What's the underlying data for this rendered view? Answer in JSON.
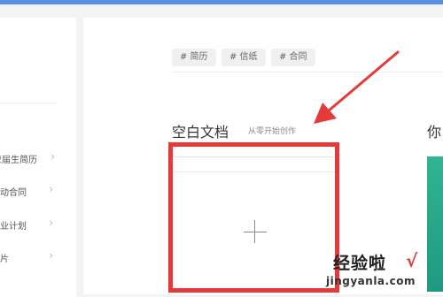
{
  "sidebar": {
    "items": [
      {
        "label": "应届生简历"
      },
      {
        "label": "劳动合同"
      },
      {
        "label": "创业计划"
      },
      {
        "label": "名片"
      }
    ]
  },
  "tags": [
    {
      "label": "# 简历"
    },
    {
      "label": "# 信纸"
    },
    {
      "label": "# 合同"
    }
  ],
  "blank_section": {
    "title": "空白文档",
    "subtitle": "从零开始创作"
  },
  "next_section": {
    "title": "你"
  },
  "card": {
    "icon": "plus-icon"
  },
  "annotation": {
    "color": "#e53a3a"
  },
  "watermark": {
    "main": "经验啦",
    "check": "√",
    "sub": "jingyanla.com"
  },
  "colors": {
    "topbar": "#5b8fe6",
    "template_preview": "#30b592"
  }
}
